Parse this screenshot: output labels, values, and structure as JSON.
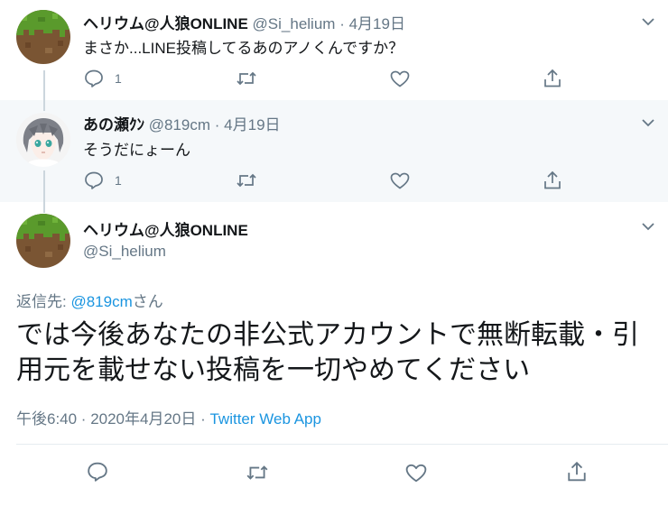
{
  "thread": [
    {
      "name": "ヘリウム@人狼ONLINE",
      "handle": "@Si_helium",
      "dot": "·",
      "date": "4月19日",
      "text": "まさか...LINE投稿してるあのアノくんですか？",
      "reply_count": "1",
      "avatar_icon": "grass-block-avatar"
    },
    {
      "name": "あの瀬ｸﾝ",
      "handle": "@819cm",
      "dot": "·",
      "date": "4月19日",
      "text": "そうだにょーん",
      "reply_count": "1",
      "avatar_icon": "anime-character-avatar"
    }
  ],
  "main_tweet": {
    "name": "ヘリウム@人狼ONLINE",
    "handle": "@Si_helium",
    "reply_prefix": "返信先: ",
    "reply_handle": "@819cm",
    "reply_suffix": "さん",
    "text": "では今後あなたの非公式アカウントで無断転載・引用元を載せない投稿を一切やめてください",
    "time": "午後6:40 · 2020年4月20日 · ",
    "source": "Twitter Web App"
  },
  "colors": {
    "link": "#1b95e0",
    "secondary": "#657786",
    "highlight_bg": "#f5f8fa",
    "thread_line": "#ccd6dd"
  }
}
